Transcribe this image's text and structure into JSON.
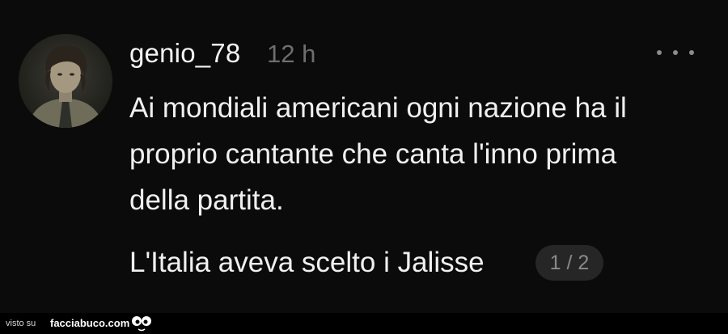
{
  "post": {
    "username": "genio_78",
    "time": "12 h",
    "lines": [
      "Ai mondiali americani ogni nazione ha il",
      "proprio cantante che canta l'inno prima",
      "della partita."
    ],
    "second_paragraph": "L'Italia aveva scelto i Jalisse",
    "pager": "1 / 2"
  },
  "footer": {
    "visto_su": "visto su",
    "brand": "facciabuco.com"
  },
  "icons": {
    "more": "more-options-icon",
    "avatar": "avatar-photo",
    "logo": "facciabuco-face-logo"
  }
}
